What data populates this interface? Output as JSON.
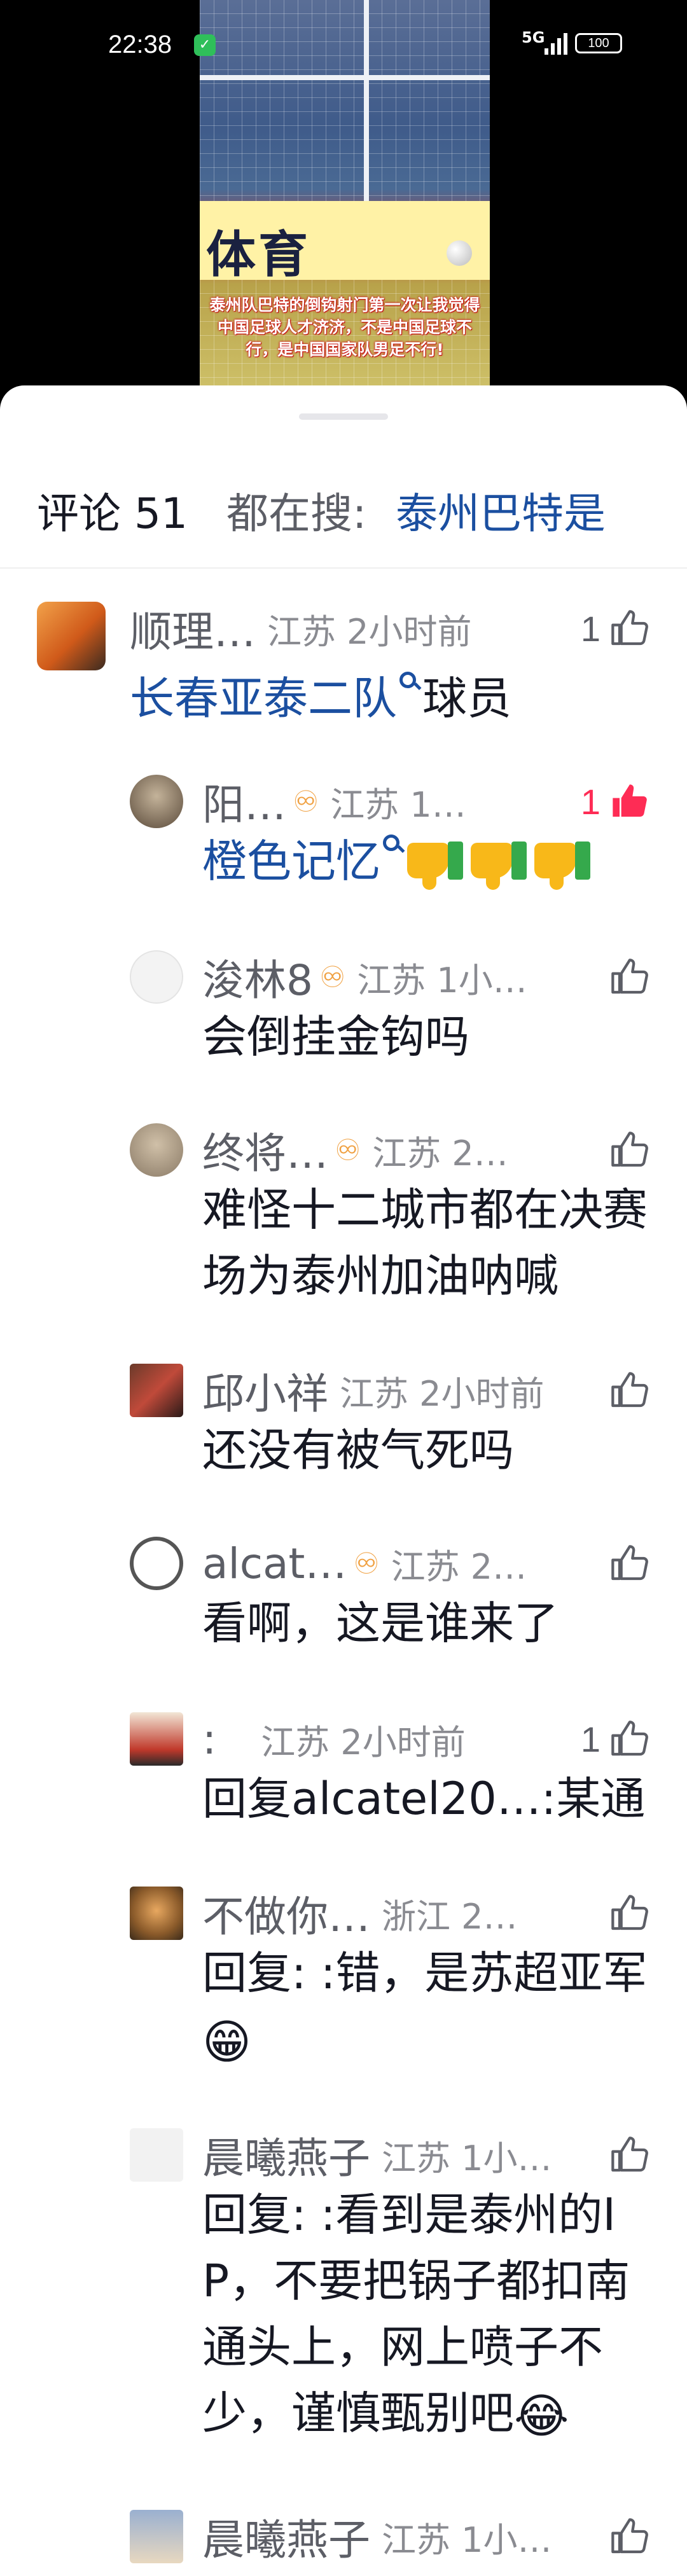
{
  "status_bar": {
    "time": "22:38",
    "network": "5G",
    "battery": "100"
  },
  "video": {
    "brand_text": "体育",
    "caption": "泰州队巴特的倒钩射门第一次让我觉得中国足球人才济济，不是中国足球不行，是中国国家队男足不行!"
  },
  "header": {
    "title": "评论 51",
    "search_label": "都在搜:",
    "search_term": "泰州巴特是"
  },
  "comments": [
    {
      "name": "顺理…",
      "region": "江苏 2小时前",
      "likes": "1",
      "body_pre": "长春亚泰二队",
      "body_post": "球员"
    },
    {
      "name": "阳…",
      "region": "江苏 1…",
      "likes": "1",
      "body": "橙色记忆"
    },
    {
      "name": "浚林8",
      "region": "江苏 1小…",
      "body": "会倒挂金钩吗"
    },
    {
      "name": "终将…",
      "region": "江苏 2…",
      "body": "难怪十二城市都在决赛场为泰州加油呐喊"
    },
    {
      "name": "邱小祥",
      "region": "江苏 2小时前",
      "body": "还没有被气死吗"
    },
    {
      "name": "alcat…",
      "region": "江苏 2…",
      "body": "看啊，这是谁来了"
    },
    {
      "name": ":",
      "region": "江苏 2小时前",
      "likes": "1",
      "body": "回复alcatel20…:某通"
    },
    {
      "name": "不做你…",
      "region": "浙江 2…",
      "body": "回复: :错，是苏超亚军"
    },
    {
      "name": "晨曦燕子",
      "region": "江苏 1小…",
      "body": "回复: :看到是泰州的IP，不要把锅子都扣南通头上，网上喷子不少，谨慎甄别吧"
    },
    {
      "name": "晨曦燕子",
      "region": "江苏 1小…"
    }
  ],
  "colors": {
    "accent_link": "#1b4fa0",
    "like_red": "#fe2c55",
    "badge": "#f0a040"
  }
}
